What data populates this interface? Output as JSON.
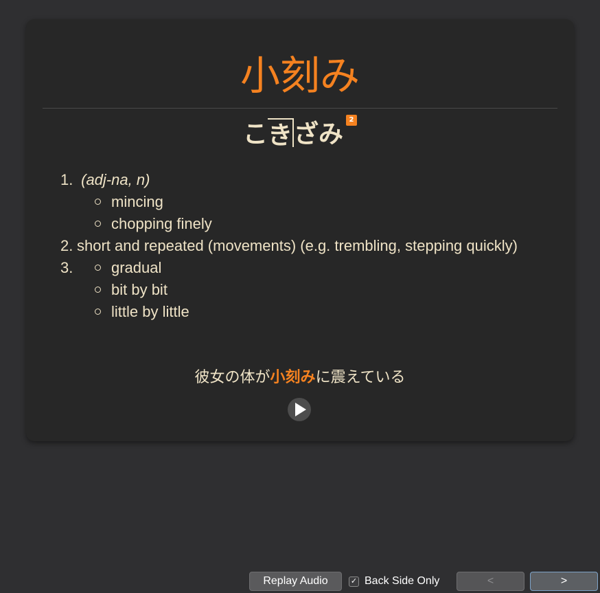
{
  "card": {
    "expression": "小刻み",
    "reading": {
      "kana": [
        "こ",
        "き",
        "ざ",
        "み"
      ],
      "pitch_number": "2"
    },
    "glossary": [
      {
        "number": "1.",
        "pos": "(adj-na, n)",
        "text": "",
        "subs": [
          "mincing",
          "chopping finely"
        ]
      },
      {
        "number": "2.",
        "pos": "",
        "text": "short and repeated (movements) (e.g. trembling, stepping quickly)",
        "subs": []
      },
      {
        "number": "3.",
        "pos": "",
        "text": "",
        "subs": [
          "gradual",
          "bit by bit",
          "little by little"
        ]
      }
    ],
    "sentence": {
      "before": "彼女の体が",
      "highlight": "小刻み",
      "after": "に震えている"
    },
    "play_icon": "play-icon"
  },
  "toolbar": {
    "replay_label": "Replay Audio",
    "back_side_only_label": "Back Side Only",
    "back_side_only_checked": true,
    "checkmark": "✓",
    "prev_label": "<",
    "next_label": ">"
  },
  "colors": {
    "accent": "#f58220",
    "text": "#efe3c6",
    "card_bg": "#272727",
    "window_bg": "#2f2f31"
  }
}
